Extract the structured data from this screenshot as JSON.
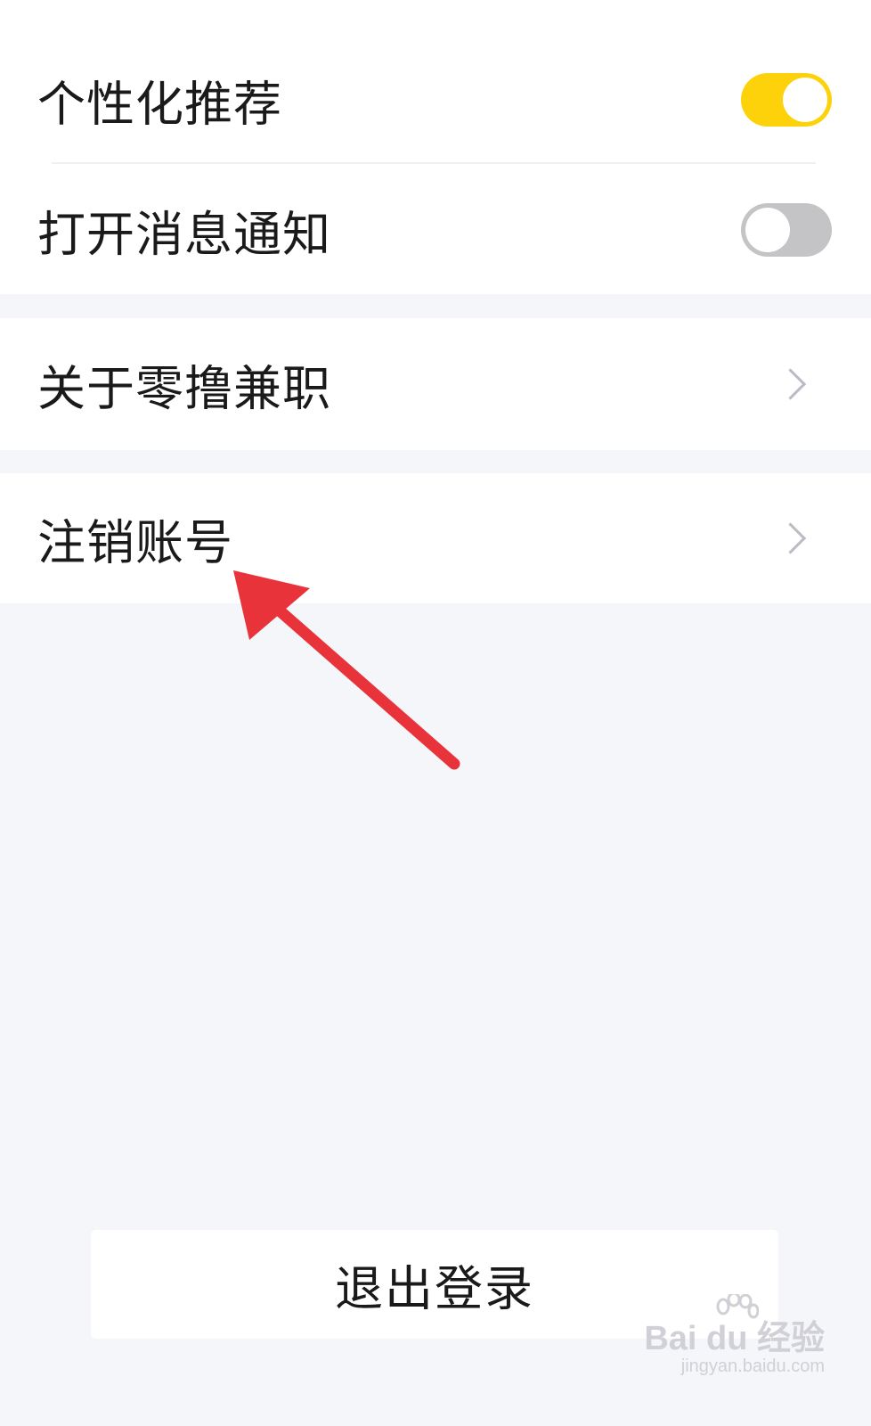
{
  "settings": {
    "items": [
      {
        "label": "个性化推荐",
        "control": "toggle",
        "state": "on"
      },
      {
        "label": "打开消息通知",
        "control": "toggle",
        "state": "off"
      },
      {
        "label": "关于零撸兼职",
        "control": "chevron"
      },
      {
        "label": "注销账号",
        "control": "chevron"
      }
    ],
    "logout_label": "退出登录"
  },
  "watermark": {
    "brand": "Bai du 经验",
    "url": "jingyan.baidu.com"
  },
  "colors": {
    "accent": "#fdd20a",
    "toggle_off": "#c4c4c6",
    "annotation_arrow": "#e8333a",
    "background": "#f5f6fa"
  }
}
